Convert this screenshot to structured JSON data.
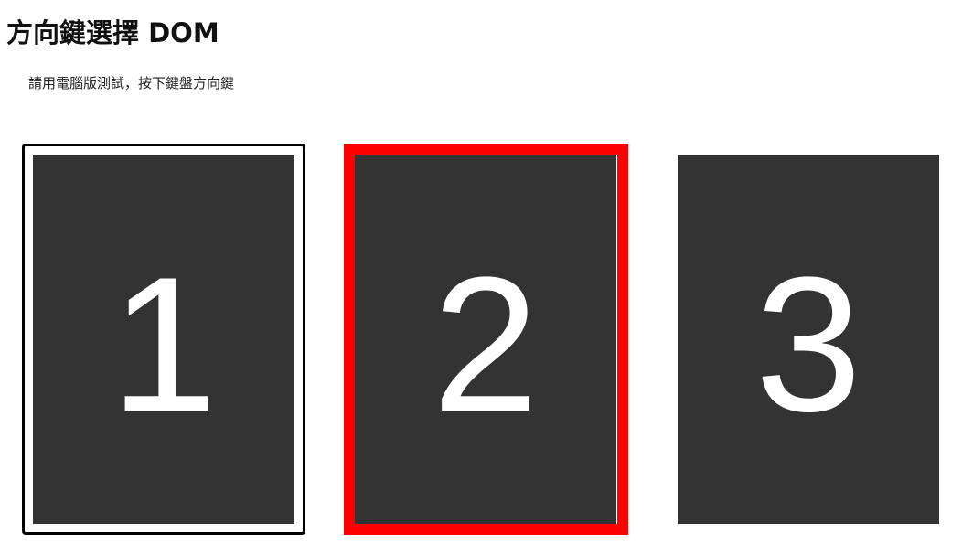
{
  "page": {
    "title": "方向鍵選擇 DOM",
    "instructions": "請用電腦版測試，按下鍵盤方向鍵"
  },
  "cards": [
    {
      "label": "1",
      "state": "focused"
    },
    {
      "label": "2",
      "state": "selected"
    },
    {
      "label": "3",
      "state": "normal"
    }
  ],
  "colors": {
    "card_background": "#333333",
    "card_text": "#ffffff",
    "selected_border": "#ff0000",
    "focus_border": "#000000"
  }
}
